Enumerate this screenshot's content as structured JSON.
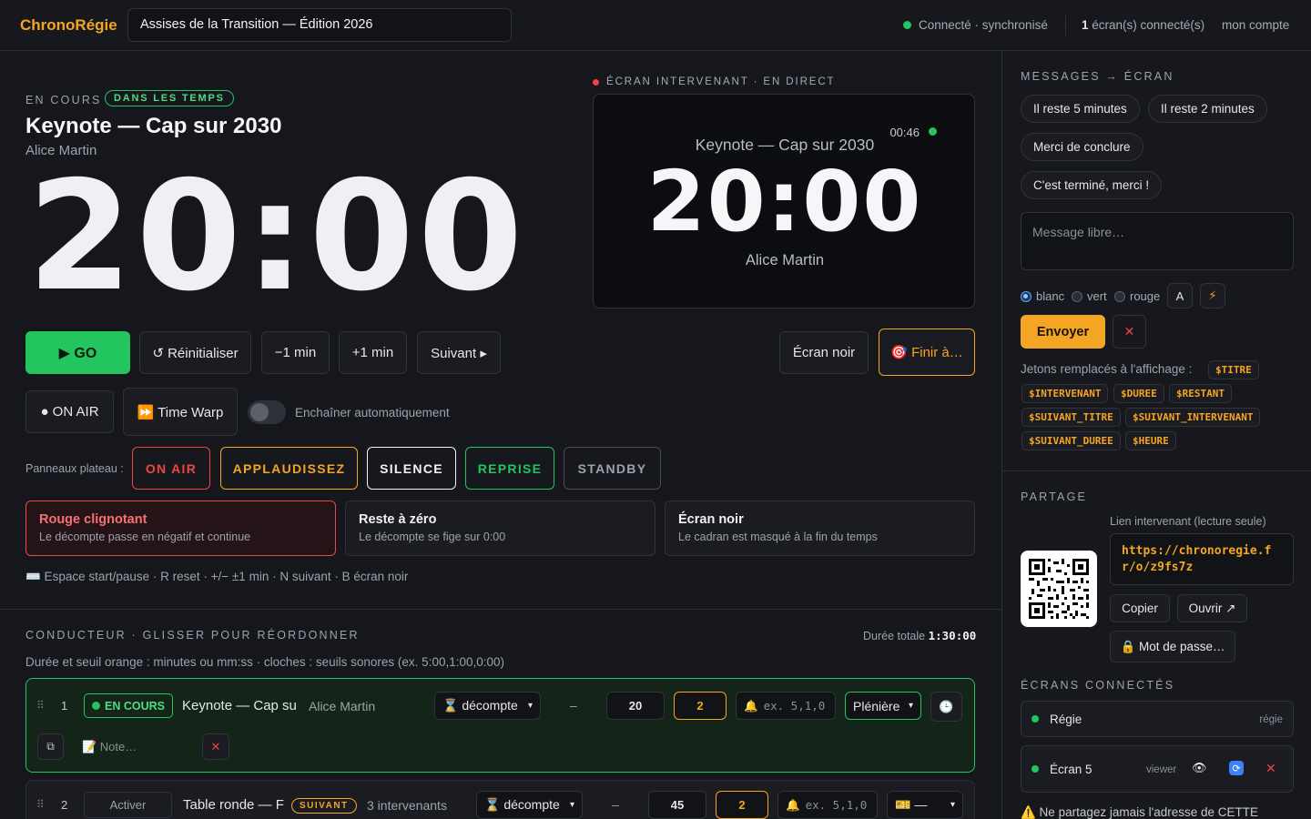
{
  "header": {
    "brand": "ChronoRégie",
    "event_title": "Assises de la Transition — Édition 2026",
    "connection_status": "Connecté · synchronisé",
    "screens_count": "1",
    "screens_label": "écran(s) connecté(s)",
    "account": "mon compte",
    "status_color": "#22c55e"
  },
  "current": {
    "label": "EN COURS",
    "status_badge": "DANS LES TEMPS",
    "title": "Keynote — Cap sur 2030",
    "speaker": "Alice Martin",
    "clock": "20:00"
  },
  "preview": {
    "label": "ÉCRAN INTERVENANT · EN DIRECT",
    "time": "00:46",
    "title": "Keynote — Cap sur 2030",
    "clock": "20:00",
    "speaker": "Alice Martin"
  },
  "controls": {
    "go": "▶ GO",
    "reset": "↺ Réinitialiser",
    "minus": "−1 min",
    "plus": "+1 min",
    "next": "Suivant ▸",
    "blackout": "Écran noir",
    "finish": "🎯 Finir à…",
    "onair": "● ON AIR",
    "timewarp": "⏩ Time Warp",
    "autochain": "Enchaîner automatiquement"
  },
  "panels": {
    "label": "Panneaux plateau :",
    "items": [
      {
        "label": "ON AIR",
        "color": "#ef4444"
      },
      {
        "label": "APPLAUDISSEZ",
        "color": "#f5a524"
      },
      {
        "label": "SILENCE",
        "color": "#f2f3f5"
      },
      {
        "label": "REPRISE",
        "color": "#22c55e"
      },
      {
        "label": "STANDBY",
        "color": "#9ea2ab"
      }
    ]
  },
  "modes": [
    {
      "title": "Rouge clignotant",
      "desc": "Le décompte passe en négatif et continue",
      "active": true
    },
    {
      "title": "Reste à zéro",
      "desc": "Le décompte se fige sur 0:00",
      "active": false
    },
    {
      "title": "Écran noir",
      "desc": "Le cadran est masqué à la fin du temps",
      "active": false
    }
  ],
  "shortcuts": "⌨️ Espace start/pause · R reset · +/− ±1 min · N suivant · B écran noir",
  "conductor": {
    "label": "CONDUCTEUR · GLISSER POUR RÉORDONNER",
    "total_label": "Durée totale",
    "total": "1:30:00",
    "hint": "Durée et seuil orange : minutes ou mm:ss · cloches : seuils sonores (ex. 5:00,1:00,0:00)",
    "rows": [
      {
        "index": "1",
        "status": "EN COURS",
        "title": "Keynote — Cap su",
        "speaker": "Alice Martin",
        "mode": "⌛ décompte",
        "dash": "–",
        "duration": "20",
        "orange": "2",
        "bells_placeholder": "ex. 5,1,0",
        "room": "Plénière",
        "note_placeholder": "📝 Note…"
      },
      {
        "index": "2",
        "action": "Activer",
        "title": "Table ronde — F",
        "badge": "SUIVANT",
        "speaker": "3 intervenants",
        "mode": "⌛ décompte",
        "dash": "–",
        "duration": "45",
        "orange": "2",
        "bells_placeholder": "ex. 5,1,0",
        "room": "🎫 —"
      }
    ]
  },
  "messages": {
    "label": "MESSAGES → ÉCRAN",
    "presets": [
      "Il reste 5 minutes",
      "Il reste 2 minutes",
      "Merci de conclure",
      "C'est terminé, merci !"
    ],
    "placeholder": "Message libre…",
    "colors": [
      "blanc",
      "vert",
      "rouge"
    ],
    "selected_color": "blanc",
    "font_button": "A",
    "flash_button": "⚡",
    "send": "Envoyer",
    "tokens_label": "Jetons remplacés à l'affichage :",
    "tokens": [
      "$TITRE",
      "$INTERVENANT",
      "$DUREE",
      "$RESTANT",
      "$SUIVANT_TITRE",
      "$SUIVANT_INTERVENANT",
      "$SUIVANT_DUREE",
      "$HEURE"
    ]
  },
  "share": {
    "label": "PARTAGE",
    "link_label": "Lien intervenant (lecture seule)",
    "link": "https://chronoregie.fr/o/z9fs7z",
    "copy": "Copier",
    "open": "Ouvrir ↗",
    "password": "🔒 Mot de passe…"
  },
  "connected": {
    "label": "ÉCRANS CONNECTÉS",
    "screens": [
      {
        "name": "Régie",
        "role": "régie"
      },
      {
        "name": "Écran 5",
        "role": "viewer"
      }
    ],
    "warning": "⚠️ Ne partagez jamais l'adresse de CETTE"
  }
}
